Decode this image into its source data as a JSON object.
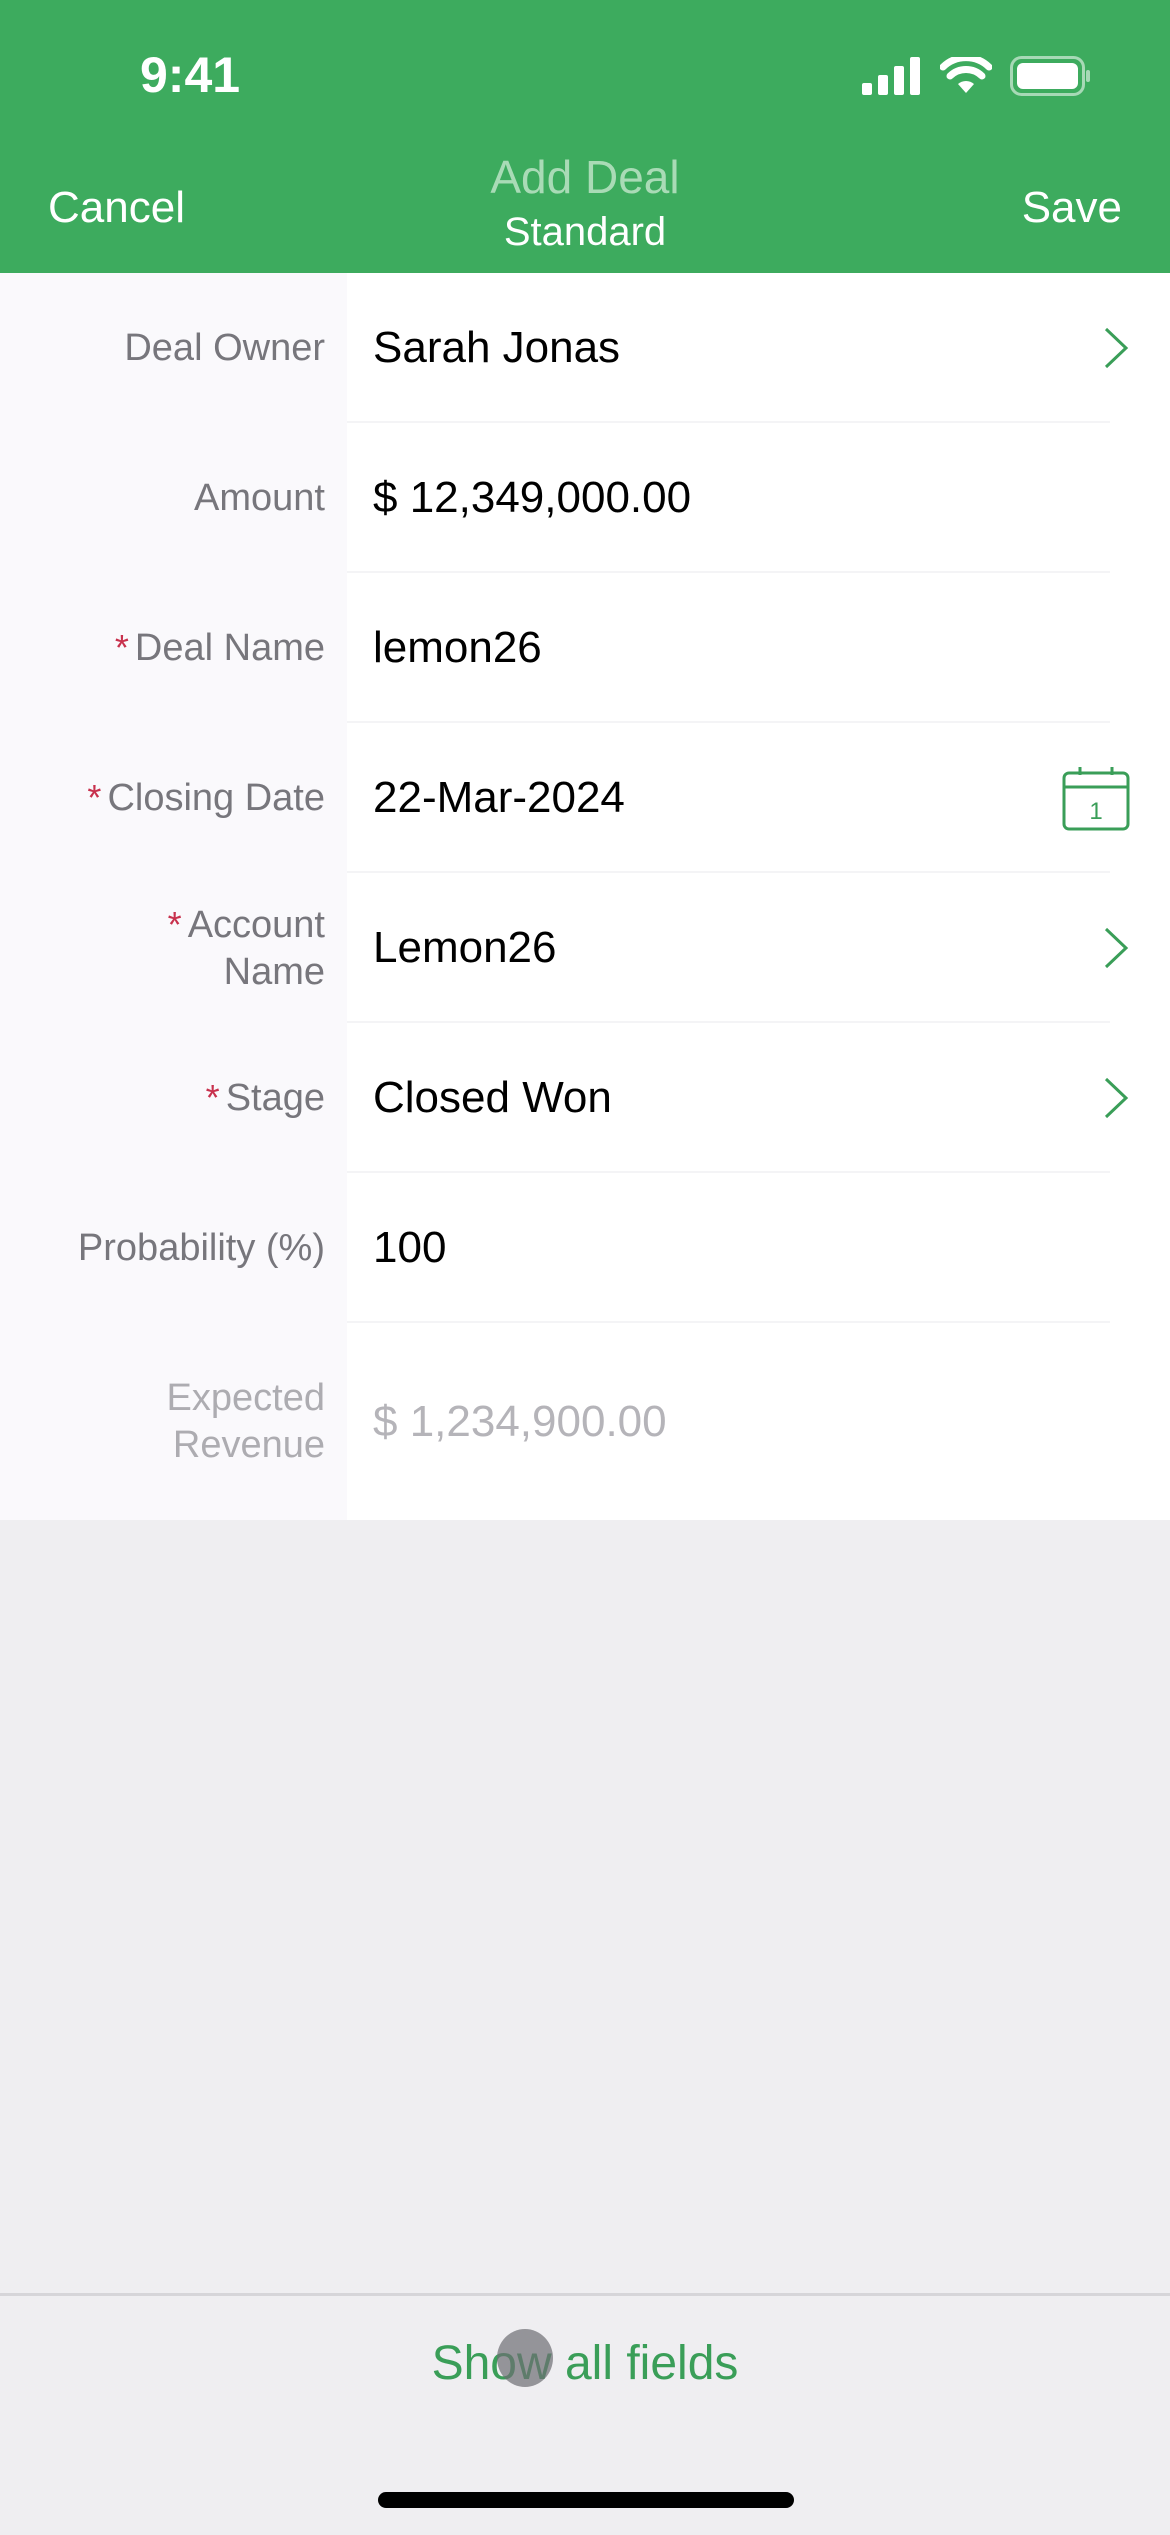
{
  "status_bar": {
    "time": "9:41",
    "icons": [
      "signal-icon",
      "wifi-icon",
      "battery-icon"
    ]
  },
  "nav": {
    "cancel_label": "Cancel",
    "title": "Add Deal",
    "subtitle": "Standard",
    "save_label": "Save"
  },
  "colors": {
    "brand_green": "#3dab5e",
    "required_red": "#c8314d",
    "link_green": "#3a9e58"
  },
  "fields": [
    {
      "label": "Deal Owner",
      "required": false,
      "value": "Sarah Jonas",
      "accessory": "chevron-right-icon"
    },
    {
      "label": "Amount",
      "required": false,
      "value": "$ 12,349,000.00",
      "accessory": ""
    },
    {
      "label": "Deal Name",
      "required": true,
      "value": "lemon26",
      "accessory": ""
    },
    {
      "label": "Closing Date",
      "required": true,
      "value": "22-Mar-2024",
      "accessory": "calendar-icon",
      "calendar_day": "1"
    },
    {
      "label_line1": "Account",
      "label_line2": "Name",
      "required": true,
      "value": "Lemon26",
      "accessory": "chevron-right-icon"
    },
    {
      "label": "Stage",
      "required": true,
      "value": "Closed Won",
      "accessory": "chevron-right-icon"
    },
    {
      "label": "Probability (%)",
      "required": false,
      "value": "100",
      "accessory": ""
    },
    {
      "label_line1": "Expected",
      "label_line2": "Revenue",
      "required": false,
      "value": "$ 1,234,900.00",
      "accessory": "",
      "disabled": true
    }
  ],
  "required_marker": "*",
  "footer": {
    "show_all_label": "Show all fields"
  }
}
